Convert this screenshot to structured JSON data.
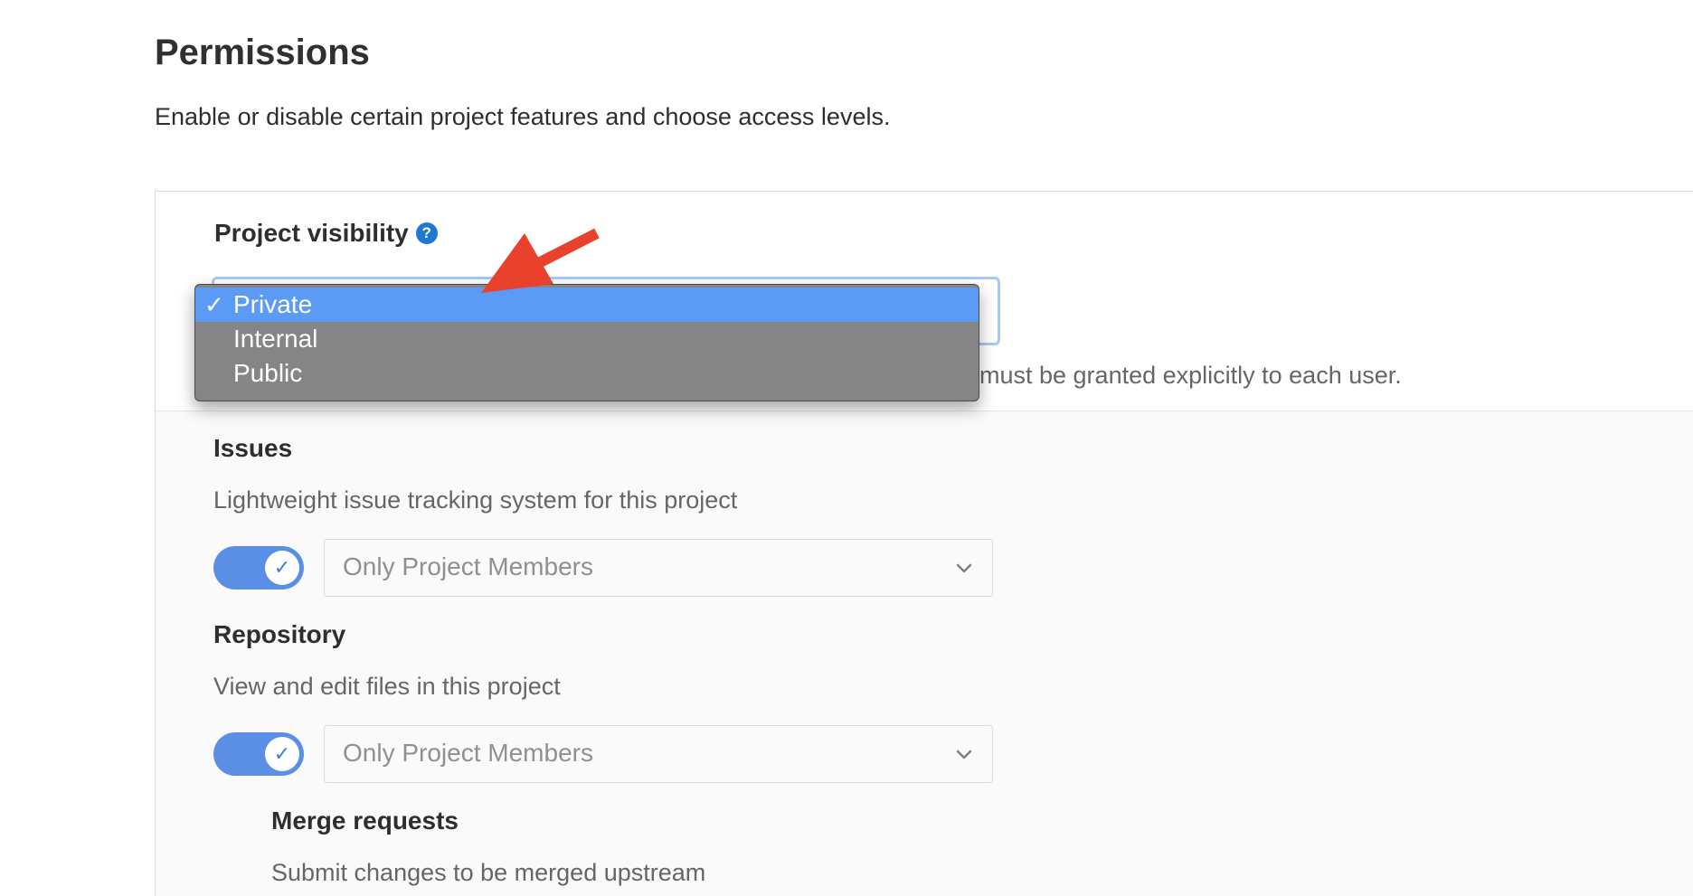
{
  "header": {
    "title": "Permissions",
    "description": "Enable or disable certain project features and choose access levels."
  },
  "visibility": {
    "label": "Project visibility",
    "help_icon": "question-circle-icon",
    "help_text": "must be granted explicitly to each user.",
    "dropdown": {
      "options": [
        "Private",
        "Internal",
        "Public"
      ],
      "selected": "Private",
      "check_mark": "✓"
    }
  },
  "annotation": {
    "arrow_color": "#e8412c"
  },
  "features": {
    "issues": {
      "title": "Issues",
      "description": "Lightweight issue tracking system for this project",
      "enabled": true,
      "access": "Only Project Members"
    },
    "repository": {
      "title": "Repository",
      "description": "View and edit files in this project",
      "enabled": true,
      "access": "Only Project Members"
    },
    "merge_requests": {
      "title": "Merge requests",
      "description": "Submit changes to be merged upstream"
    }
  },
  "colors": {
    "accent": "#5b8fe6",
    "selected_option": "#5b9bf5",
    "help_icon": "#1f78d1"
  }
}
